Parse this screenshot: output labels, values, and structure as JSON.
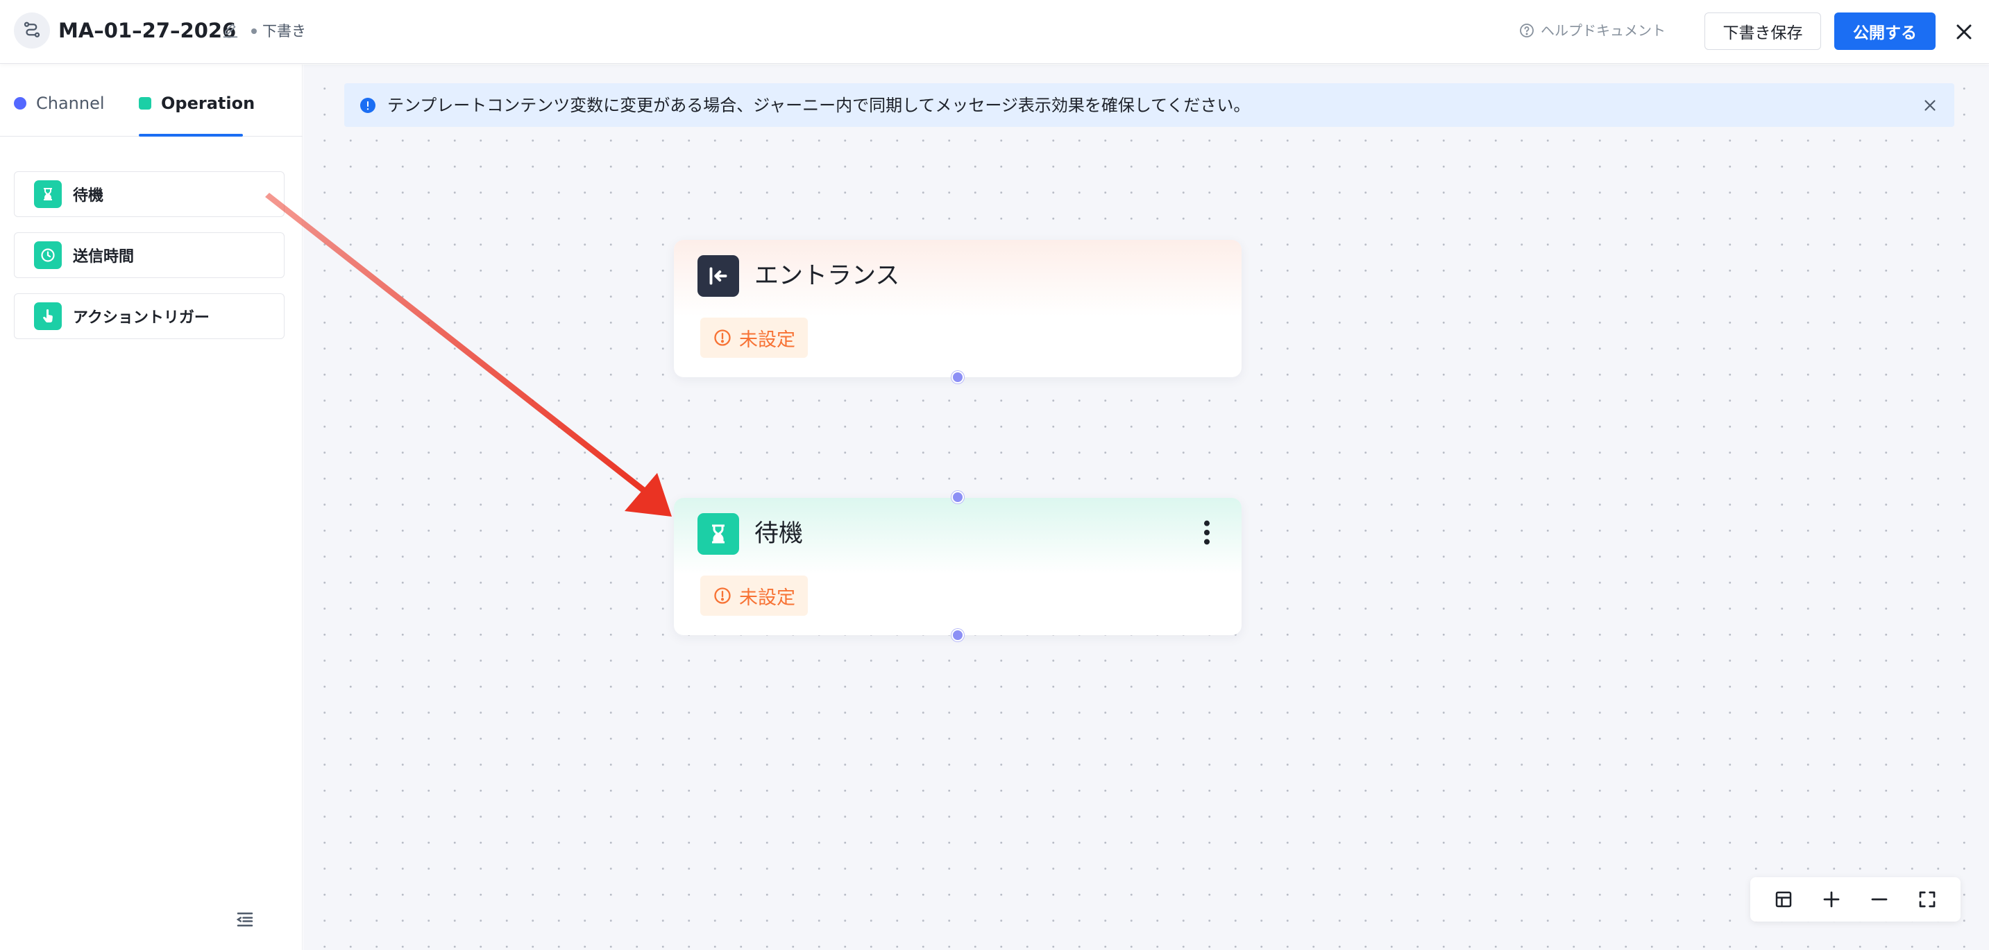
{
  "header": {
    "title": "MA–01–27–2026",
    "status_label": "下書き",
    "help_label": "ヘルプドキュメント",
    "save_label": "下書き保存",
    "publish_label": "公開する"
  },
  "sidebar": {
    "tabs": [
      {
        "label": "Channel",
        "color": "#5468ff",
        "active": false
      },
      {
        "label": "Operation",
        "color": "#1ccfa6",
        "active": true
      }
    ],
    "operations": [
      {
        "label": "待機",
        "icon": "hourglass-icon"
      },
      {
        "label": "送信時間",
        "icon": "clock-icon"
      },
      {
        "label": "アクショントリガー",
        "icon": "hand-pointer-icon"
      }
    ]
  },
  "canvas": {
    "notice_text": "テンプレートコンテンツ変数に変更がある場合、ジャーニー内で同期してメッセージ表示効果を確保してください。",
    "nodes": [
      {
        "title": "エントランス",
        "icon": "entrance-icon",
        "status": "未設定",
        "accent": "#2b3245"
      },
      {
        "title": "待機",
        "icon": "hourglass-icon",
        "status": "未設定",
        "accent": "#1ccfa6"
      }
    ]
  },
  "colors": {
    "primary": "#1b6ef3",
    "operation_green": "#1ccfa6",
    "warning_orange": "#f77234",
    "port_purple": "#8c8ff5",
    "annotation_arrow": "#ea3323"
  }
}
